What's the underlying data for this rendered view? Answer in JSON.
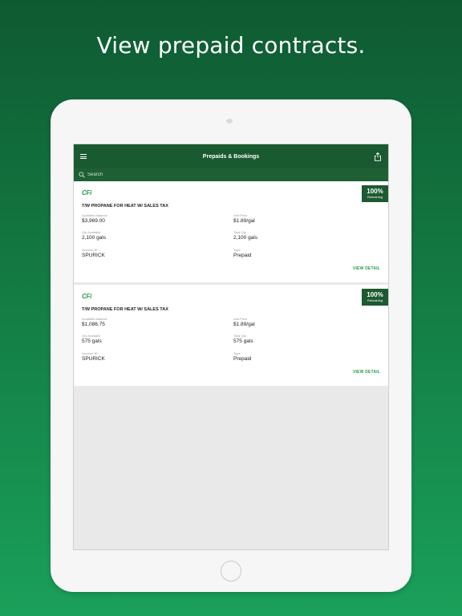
{
  "headline": "View prepaid contracts.",
  "nav": {
    "title": "Prepaids & Bookings",
    "menu_icon": "hamburger-icon",
    "share_icon": "share-icon"
  },
  "search": {
    "placeholder": "Search",
    "icon": "search-icon"
  },
  "colors": {
    "brand_green": "#195a30",
    "accent_green": "#2a9a4a",
    "badge_green": "#1d5a31"
  },
  "cards": [
    {
      "logo": "CFi",
      "badge_percent": "100%",
      "badge_label": "Remaining",
      "product": "T/W PROPANE FOR HEAT W/ SALES TAX",
      "available_balance_label": "Available Balance",
      "available_balance": "$3,969.00",
      "unit_price_label": "Unit Price",
      "unit_price": "$1.89/gal",
      "qty_available_label": "Qty Available",
      "qty_available": "2,100 gals",
      "total_qty_label": "Total Qty",
      "total_qty": "2,100 gals",
      "account_id_label": "Account ID",
      "account_id": "SPURICK",
      "type_label": "Type",
      "type": "Prepaid",
      "view_detail": "VIEW DETAIL"
    },
    {
      "logo": "CFi",
      "badge_percent": "100%",
      "badge_label": "Remaining",
      "product": "T/W PROPANE FOR HEAT W/ SALES TAX",
      "available_balance_label": "Available Balance",
      "available_balance": "$1,086.75",
      "unit_price_label": "Unit Price",
      "unit_price": "$1.89/gal",
      "qty_available_label": "Qty Available",
      "qty_available": "575 gals",
      "total_qty_label": "Total Qty",
      "total_qty": "575 gals",
      "account_id_label": "Account ID",
      "account_id": "SPURICK",
      "type_label": "Type",
      "type": "Prepaid",
      "view_detail": "VIEW DETAIL"
    }
  ]
}
